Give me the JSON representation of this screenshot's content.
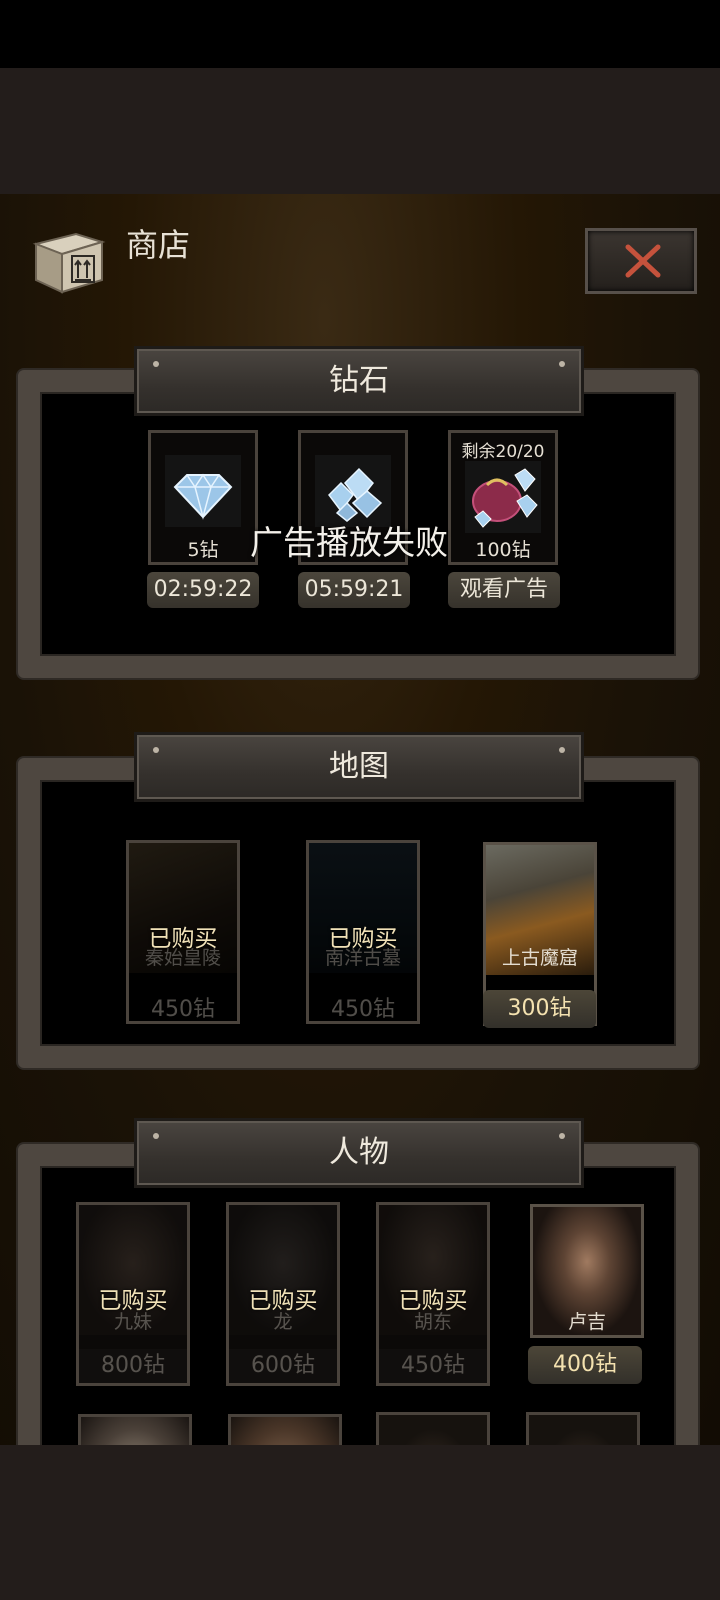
{
  "header": {
    "title": "商店"
  },
  "toast": "广告播放失败",
  "diamond_section": {
    "title": "钻石",
    "items": [
      {
        "amount": "5钻",
        "button": "02:59:22"
      },
      {
        "amount": "",
        "button": "05:59:21"
      },
      {
        "remaining": "剩余20/20",
        "amount": "100钻",
        "button": "观看广告"
      }
    ]
  },
  "map_section": {
    "title": "地图",
    "items": [
      {
        "name": "秦始皇陵",
        "price": "450钻",
        "status": "已购买"
      },
      {
        "name": "南洋古墓",
        "price": "450钻",
        "status": "已购买"
      },
      {
        "name": "上古魔窟",
        "price": "300钻"
      }
    ]
  },
  "character_section": {
    "title": "人物",
    "items": [
      {
        "name": "九妹",
        "price": "800钻",
        "status": "已购买"
      },
      {
        "name": "龙",
        "price": "600钻",
        "status": "已购买"
      },
      {
        "name": "胡东",
        "price": "450钻",
        "status": "已购买"
      },
      {
        "name": "卢吉",
        "price": "400钻"
      }
    ]
  },
  "colors": {
    "gold_text": "#f1e2b8",
    "close_x": "#c5523c",
    "panel_frame": "#4e4740"
  }
}
